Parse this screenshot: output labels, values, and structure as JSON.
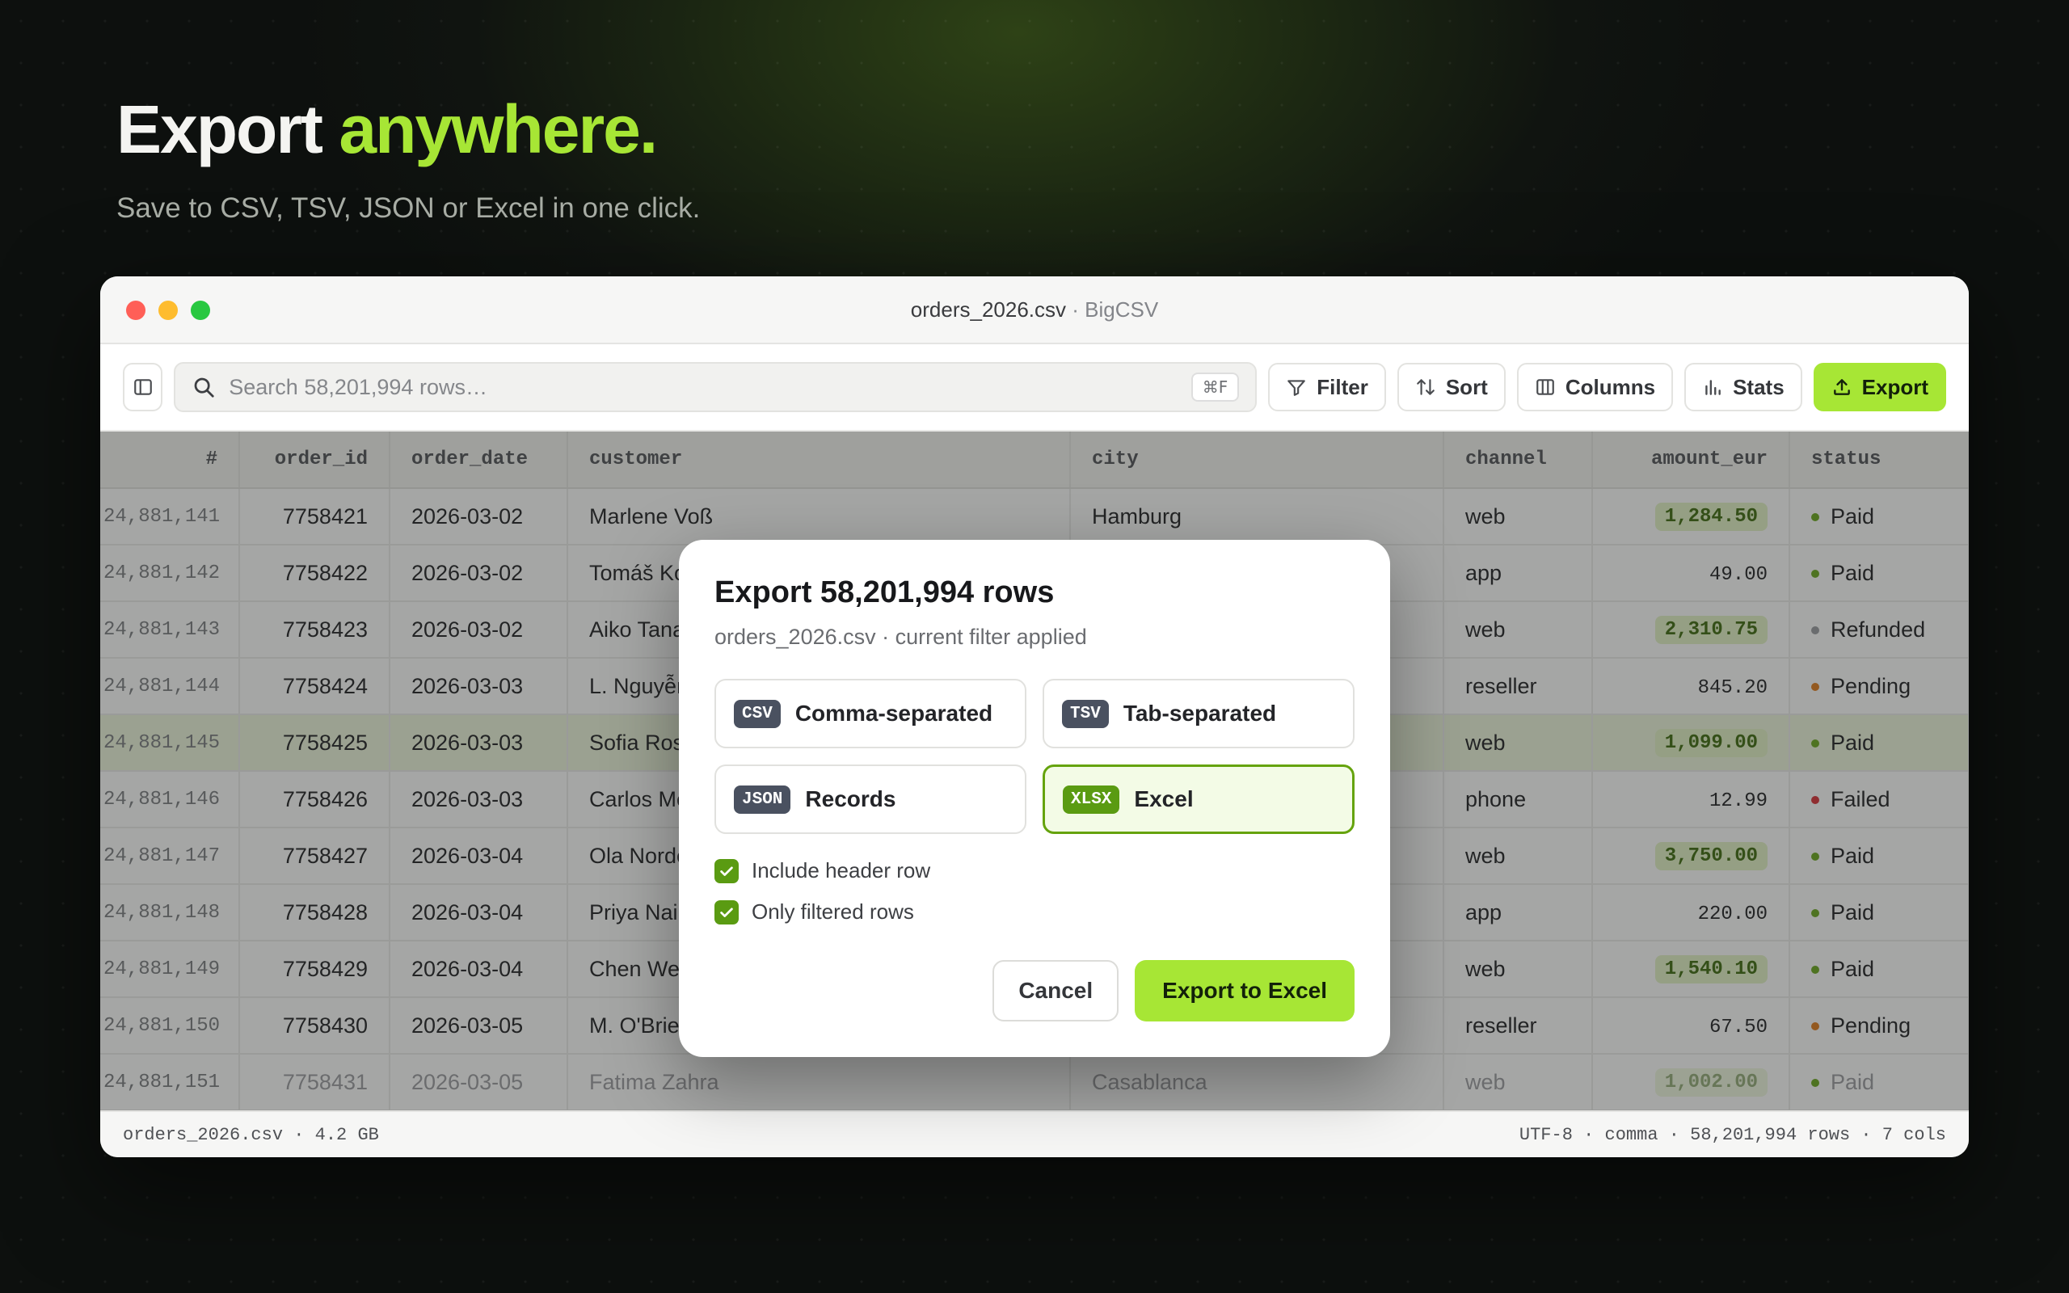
{
  "hero": {
    "title_main": "Export ",
    "title_accent": "anywhere.",
    "subtitle": "Save to CSV, TSV, JSON or Excel in one click."
  },
  "window": {
    "file": "orders_2026.csv",
    "separator": " · ",
    "app": "BigCSV"
  },
  "toolbar": {
    "search_placeholder": "Search 58,201,994 rows…",
    "search_shortcut": "⌘F",
    "filter": "Filter",
    "sort": "Sort",
    "columns": "Columns",
    "stats": "Stats",
    "export": "Export"
  },
  "colors": {
    "accent": "#a7e635",
    "dot_green": "#6aa81c",
    "dot_gray": "#9a9ca0",
    "dot_orange": "#e07b1a",
    "dot_red": "#d93036"
  },
  "table": {
    "headers": [
      "#",
      "order_id",
      "order_date",
      "customer",
      "city",
      "channel",
      "amount_eur",
      "status"
    ],
    "rows": [
      {
        "n": "24,881,141",
        "id": "7758421",
        "date": "2026-03-02",
        "customer": "Marlene Voß",
        "city": "Hamburg",
        "channel": "web",
        "amount": "1,284.50",
        "chip": true,
        "status": "Paid",
        "dot": "dot_green"
      },
      {
        "n": "24,881,142",
        "id": "7758422",
        "date": "2026-03-02",
        "customer": "Tomáš Ko",
        "city": "",
        "channel": "app",
        "amount": "49.00",
        "chip": false,
        "status": "Paid",
        "dot": "dot_green"
      },
      {
        "n": "24,881,143",
        "id": "7758423",
        "date": "2026-03-02",
        "customer": "Aiko Tana",
        "city": "",
        "channel": "web",
        "amount": "2,310.75",
        "chip": true,
        "status": "Refunded",
        "dot": "dot_gray"
      },
      {
        "n": "24,881,144",
        "id": "7758424",
        "date": "2026-03-03",
        "customer": "L. Nguyễn",
        "city": "",
        "channel": "reseller",
        "amount": "845.20",
        "chip": false,
        "status": "Pending",
        "dot": "dot_orange"
      },
      {
        "n": "24,881,145",
        "id": "7758425",
        "date": "2026-03-03",
        "customer": "Sofia Ros",
        "city": "",
        "channel": "web",
        "amount": "1,099.00",
        "chip": true,
        "status": "Paid",
        "dot": "dot_green",
        "highlight": true
      },
      {
        "n": "24,881,146",
        "id": "7758426",
        "date": "2026-03-03",
        "customer": "Carlos Mé",
        "city": "",
        "channel": "phone",
        "amount": "12.99",
        "chip": false,
        "status": "Failed",
        "dot": "dot_red"
      },
      {
        "n": "24,881,147",
        "id": "7758427",
        "date": "2026-03-04",
        "customer": "Ola Nordé",
        "city": "",
        "channel": "web",
        "amount": "3,750.00",
        "chip": true,
        "status": "Paid",
        "dot": "dot_green"
      },
      {
        "n": "24,881,148",
        "id": "7758428",
        "date": "2026-03-04",
        "customer": "Priya Nair",
        "city": "",
        "channel": "app",
        "amount": "220.00",
        "chip": false,
        "status": "Paid",
        "dot": "dot_green"
      },
      {
        "n": "24,881,149",
        "id": "7758429",
        "date": "2026-03-04",
        "customer": "Chen Wei",
        "city": "",
        "channel": "web",
        "amount": "1,540.10",
        "chip": true,
        "status": "Paid",
        "dot": "dot_green"
      },
      {
        "n": "24,881,150",
        "id": "7758430",
        "date": "2026-03-05",
        "customer": "M. O'Brien",
        "city": "",
        "channel": "reseller",
        "amount": "67.50",
        "chip": false,
        "status": "Pending",
        "dot": "dot_orange"
      },
      {
        "n": "24,881,151",
        "id": "7758431",
        "date": "2026-03-05",
        "customer": "Fatima Zahra",
        "city": "Casablanca",
        "channel": "web",
        "amount": "1,002.00",
        "chip": true,
        "status": "Paid",
        "dot": "dot_green",
        "fade": true
      }
    ]
  },
  "statusbar": {
    "left": "orders_2026.csv · 4.2 GB",
    "right": "UTF-8 · comma · 58,201,994 rows · 7 cols"
  },
  "modal": {
    "title": "Export 58,201,994 rows",
    "subtitle": "orders_2026.csv · current filter applied",
    "formats": [
      {
        "badge": "CSV",
        "label": "Comma-separated",
        "selected": false
      },
      {
        "badge": "TSV",
        "label": "Tab-separated",
        "selected": false
      },
      {
        "badge": "JSON",
        "label": "Records",
        "selected": false
      },
      {
        "badge": "XLSX",
        "label": "Excel",
        "selected": true
      }
    ],
    "include_header": "Include header row",
    "only_filtered": "Only filtered rows",
    "cancel": "Cancel",
    "confirm": "Export to Excel"
  }
}
